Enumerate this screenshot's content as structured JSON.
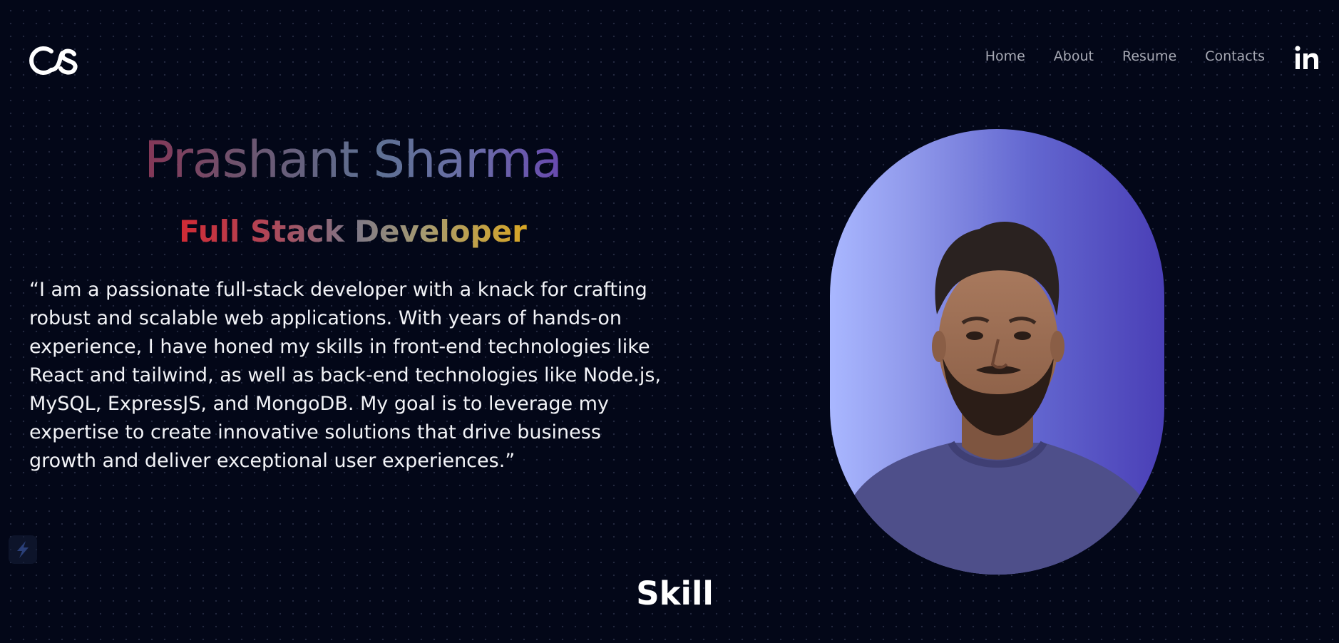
{
  "header": {
    "logo_icon": "cs-logo-icon",
    "nav": [
      {
        "label": "Home"
      },
      {
        "label": "About"
      },
      {
        "label": "Resume"
      },
      {
        "label": "Contacts"
      }
    ],
    "social_icon": "linkedin-icon"
  },
  "hero": {
    "name": "Prashant Sharma",
    "role": "Full Stack Developer",
    "bio": "“I am a passionate full-stack developer with a knack for crafting robust and scalable web applications. With years of hands-on experience, I have honed my skills in front-end technologies like React and tailwind, as well as back-end technologies like Node.js, MySQL, ExpressJS, and MongoDB. My goal is to leverage my expertise to create innovative solutions that drive business growth and deliver exceptional user experiences.”"
  },
  "portrait": {
    "icon": "profile-photo"
  },
  "side_widget": {
    "icon": "lightning-bolt-icon"
  },
  "skills_section": {
    "title": "Skill"
  },
  "colors": {
    "background": "#030718",
    "nav_text": "#a7a9b4",
    "body_text": "#f2f3f7",
    "portrait_gradient_start": "#a9b7ff",
    "portrait_gradient_end": "#4a3fb6"
  }
}
